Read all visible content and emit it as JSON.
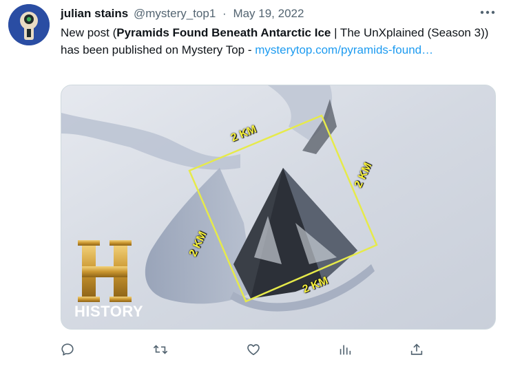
{
  "tweet": {
    "author_name": "julian stains",
    "handle": "@mystery_top1",
    "separator": "·",
    "date": "May 19, 2022",
    "text_prefix": "New post (",
    "text_bold": "Pyramids Found Beneath Antarctic Ice",
    "text_middle": " | The UnXplained (Season 3)) has been published on Mystery Top - ",
    "link_text": "mysterytop.com/pyramids-found…"
  },
  "media": {
    "logo_word": "HISTORY",
    "logo_letter": "H",
    "km_labels": [
      "2 KM",
      "2 KM",
      "2 KM",
      "2 KM"
    ]
  },
  "actions": [
    {
      "icon": "reply-icon"
    },
    {
      "icon": "retweet-icon"
    },
    {
      "icon": "like-icon"
    },
    {
      "icon": "analytics-icon"
    },
    {
      "icon": "share-icon"
    }
  ],
  "colors": {
    "accent": "#1d9bf0",
    "secondary_text": "#536471",
    "annotation_yellow": "#f5ef3a"
  }
}
